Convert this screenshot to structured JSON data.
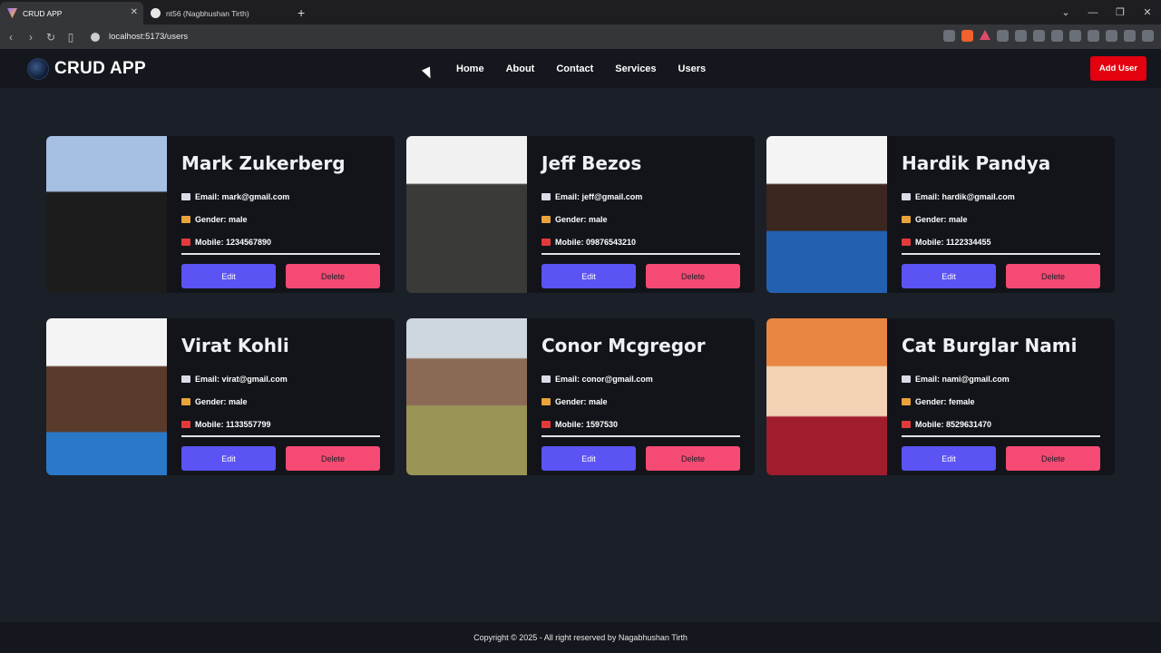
{
  "browser": {
    "tabs": [
      {
        "title": "CRUD APP",
        "active": true
      },
      {
        "title": "nt56 (Nagbhushan Tirth)",
        "active": false
      }
    ],
    "new_tab": "+",
    "url": "localhost:5173/users",
    "window_controls": [
      "⌄",
      "—",
      "❐",
      "✕"
    ]
  },
  "header": {
    "logo_text": "CRUD APP",
    "nav": [
      "Home",
      "About",
      "Contact",
      "Services",
      "Users"
    ],
    "add_user_label": "Add User"
  },
  "users": [
    {
      "name": "Mark Zukerberg",
      "email": "Email: mark@gmail.com",
      "gender": "Gender: male",
      "mobile": "Mobile: 1234567890",
      "edit": "Edit",
      "delete": "Delete"
    },
    {
      "name": "Jeff Bezos",
      "email": "Email: jeff@gmail.com",
      "gender": "Gender: male",
      "mobile": "Mobile: 09876543210",
      "edit": "Edit",
      "delete": "Delete"
    },
    {
      "name": "Hardik Pandya",
      "email": "Email: hardik@gmail.com",
      "gender": "Gender: male",
      "mobile": "Mobile: 1122334455",
      "edit": "Edit",
      "delete": "Delete"
    },
    {
      "name": "Virat Kohli",
      "email": "Email: virat@gmail.com",
      "gender": "Gender: male",
      "mobile": "Mobile: 1133557799",
      "edit": "Edit",
      "delete": "Delete"
    },
    {
      "name": "Conor Mcgregor",
      "email": "Email: conor@gmail.com",
      "gender": "Gender: male",
      "mobile": "Mobile: 1597530",
      "edit": "Edit",
      "delete": "Delete"
    },
    {
      "name": "Cat Burglar Nami",
      "email": "Email: nami@gmail.com",
      "gender": "Gender: female",
      "mobile": "Mobile: 8529631470",
      "edit": "Edit",
      "delete": "Delete"
    }
  ],
  "footer": {
    "text": "Copyright © 2025 - All right reserved by Nagabhushan Tirth"
  },
  "colors": {
    "accent_red": "#e3000f",
    "edit_button": "#5b53f3",
    "delete_button": "#f54a73",
    "page_bg": "#1b1f27",
    "card_bg": "#12141a"
  }
}
